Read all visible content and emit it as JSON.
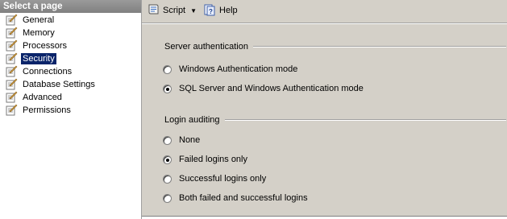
{
  "left_panel": {
    "header": "Select a page",
    "items": [
      {
        "label": "General",
        "selected": false
      },
      {
        "label": "Memory",
        "selected": false
      },
      {
        "label": "Processors",
        "selected": false
      },
      {
        "label": "Security",
        "selected": true
      },
      {
        "label": "Connections",
        "selected": false
      },
      {
        "label": "Database Settings",
        "selected": false
      },
      {
        "label": "Advanced",
        "selected": false
      },
      {
        "label": "Permissions",
        "selected": false
      }
    ]
  },
  "toolbar": {
    "script_label": "Script",
    "help_label": "Help"
  },
  "server_auth": {
    "title": "Server authentication",
    "options": [
      {
        "label": "Windows Authentication mode",
        "checked": false
      },
      {
        "label": "SQL Server and Windows Authentication mode",
        "checked": true
      }
    ]
  },
  "login_auditing": {
    "title": "Login auditing",
    "options": [
      {
        "label": "None",
        "checked": false
      },
      {
        "label": "Failed logins only",
        "checked": true
      },
      {
        "label": "Successful logins only",
        "checked": false
      },
      {
        "label": "Both failed and successful logins",
        "checked": false
      }
    ]
  },
  "colors": {
    "selection": "#0a246a",
    "panel_bg": "#d4d0c8",
    "header_bg": "#808080"
  }
}
